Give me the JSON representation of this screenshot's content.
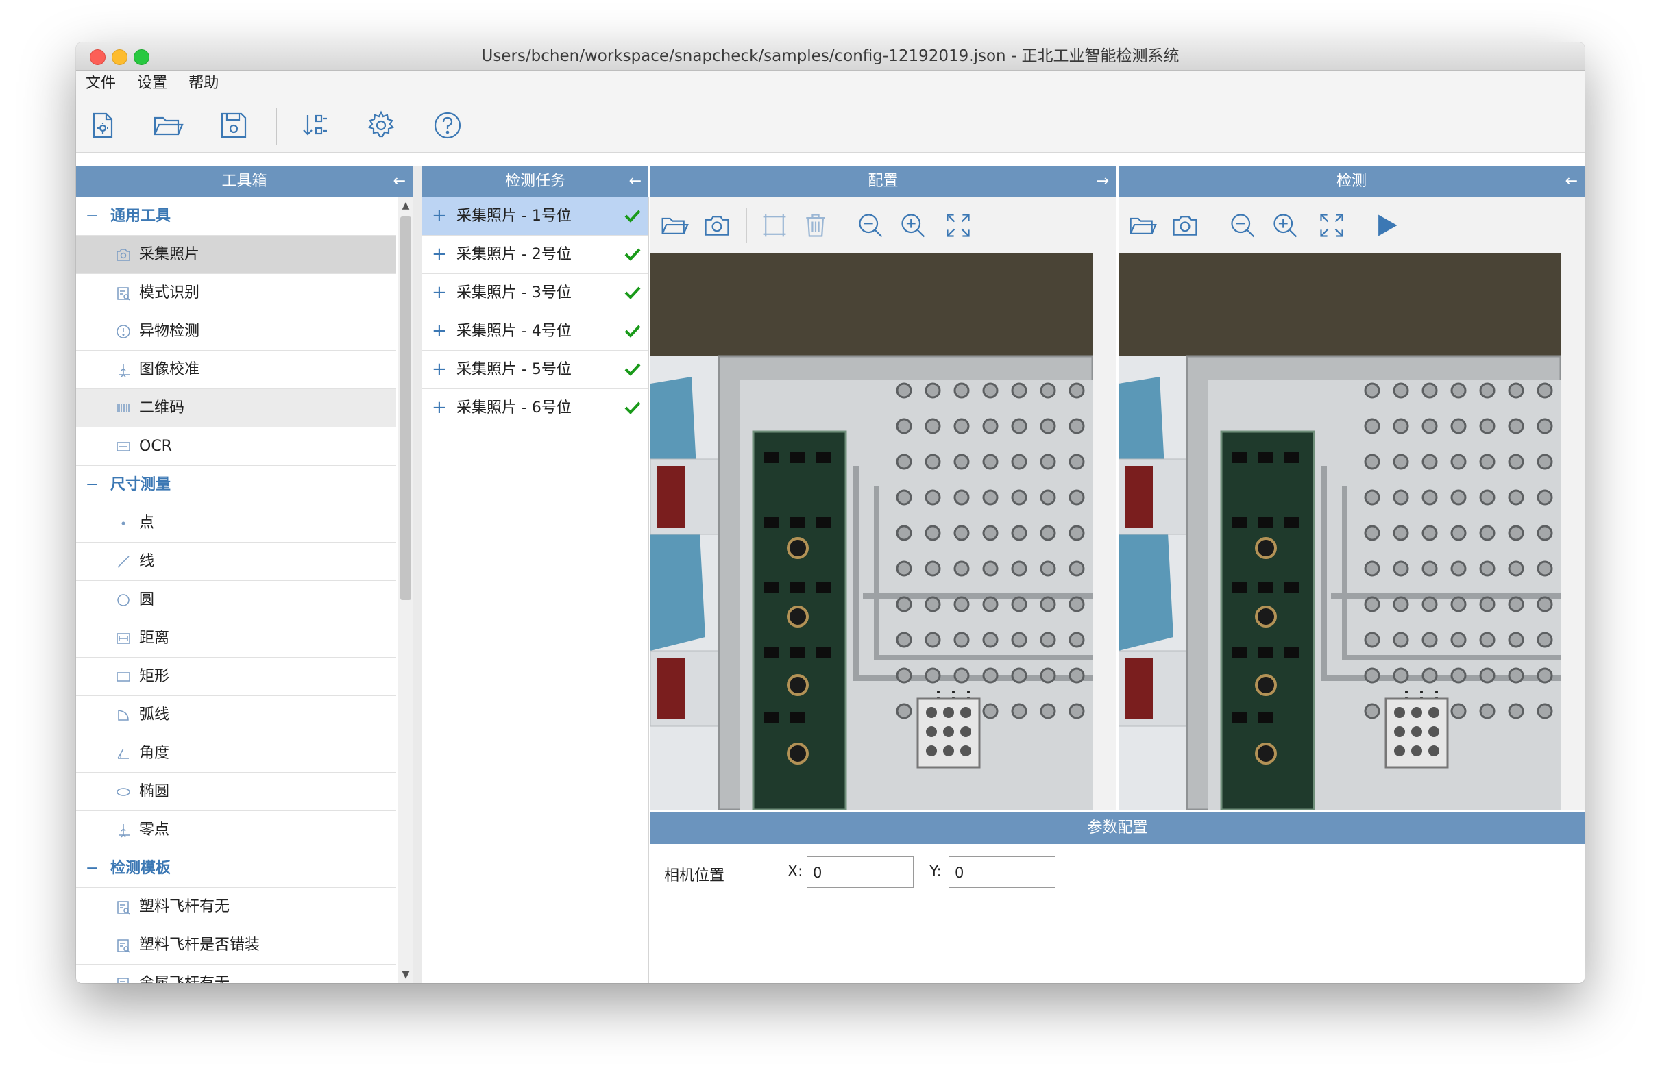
{
  "window": {
    "title": "Users/bchen/workspace/snapcheck/samples/config-12192019.json - 正北工业智能检测系统"
  },
  "menu": [
    "文件",
    "设置",
    "帮助"
  ],
  "toolbar": {
    "buttons": [
      "new-config-icon",
      "open-folder-icon",
      "save-icon",
      "sort-icon",
      "settings-icon",
      "help-icon"
    ]
  },
  "panels": {
    "toolbox": {
      "title": "工具箱",
      "collapse": "←"
    },
    "tasks": {
      "title": "检测任务",
      "collapse": "←"
    },
    "config": {
      "title": "配置",
      "collapse": "→"
    },
    "detect": {
      "title": "检测",
      "collapse": "←"
    }
  },
  "toolbox": {
    "items": [
      {
        "type": "category",
        "expand": "−",
        "label": "通用工具"
      },
      {
        "type": "item",
        "icon": "camera-icon",
        "label": "采集照片"
      },
      {
        "type": "item",
        "icon": "pattern-icon",
        "label": "模式识别"
      },
      {
        "type": "item",
        "icon": "alert-icon",
        "label": "异物检测"
      },
      {
        "type": "item",
        "icon": "calibrate-icon",
        "label": "图像校准"
      },
      {
        "type": "item",
        "icon": "barcode-icon",
        "label": "二维码"
      },
      {
        "type": "item",
        "icon": "ocr-icon",
        "label": "OCR"
      },
      {
        "type": "category",
        "expand": "−",
        "label": "尺寸测量"
      },
      {
        "type": "item",
        "icon": "point-icon",
        "label": "点"
      },
      {
        "type": "item",
        "icon": "line-icon",
        "label": "线"
      },
      {
        "type": "item",
        "icon": "circle-icon",
        "label": "圆"
      },
      {
        "type": "item",
        "icon": "distance-icon",
        "label": "距离"
      },
      {
        "type": "item",
        "icon": "rectangle-icon",
        "label": "矩形"
      },
      {
        "type": "item",
        "icon": "arc-icon",
        "label": "弧线"
      },
      {
        "type": "item",
        "icon": "angle-icon",
        "label": "角度"
      },
      {
        "type": "item",
        "icon": "ellipse-icon",
        "label": "椭圆"
      },
      {
        "type": "item",
        "icon": "origin-icon",
        "label": "零点"
      },
      {
        "type": "category",
        "expand": "−",
        "label": "检测模板"
      },
      {
        "type": "item",
        "icon": "template-icon",
        "label": "塑料飞杆有无"
      },
      {
        "type": "item",
        "icon": "template-icon",
        "label": "塑料飞杆是否错装"
      },
      {
        "type": "item",
        "icon": "template-icon",
        "label": "金属飞杆有无"
      }
    ]
  },
  "tasks": {
    "items": [
      {
        "label": "采集照片 - 1号位",
        "status": "check-icon"
      },
      {
        "label": "采集照片 - 2号位",
        "status": "check-icon"
      },
      {
        "label": "采集照片 - 3号位",
        "status": "check-icon"
      },
      {
        "label": "采集照片 - 4号位",
        "status": "check-icon"
      },
      {
        "label": "采集照片 - 5号位",
        "status": "check-icon"
      },
      {
        "label": "采集照片 - 6号位",
        "status": "check-icon"
      }
    ]
  },
  "params": {
    "title": "参数配置",
    "camera_position_label": "相机位置",
    "x_label": "X:",
    "x_value": "0",
    "y_label": "Y:",
    "y_value": "0"
  },
  "colors": {
    "panel_header": "#6b94be",
    "accent": "#3c78b4",
    "selected_task": "#bcd4f3",
    "check": "#1a9a1a"
  }
}
